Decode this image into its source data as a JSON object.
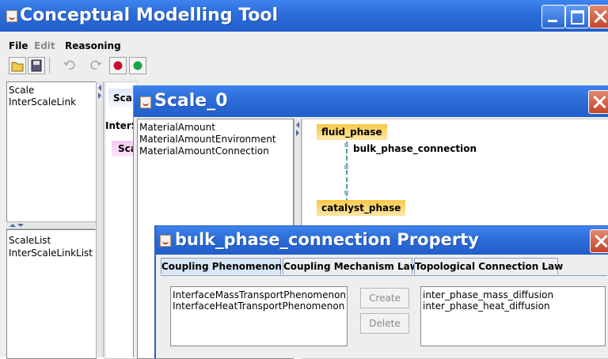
{
  "main_window": {
    "title": "Conceptual Modelling Tool",
    "menu": [
      {
        "label": "File",
        "enabled": true
      },
      {
        "label": "Edit",
        "enabled": false
      },
      {
        "label": "Reasoning",
        "enabled": true
      }
    ],
    "toolbar_icons": [
      "open-folder-icon",
      "save-icon",
      "undo-icon",
      "redo-icon",
      "red-circle-icon",
      "green-circle-icon"
    ]
  },
  "left_panel": {
    "top_list": [
      "Scale",
      "InterScaleLink"
    ],
    "bottom_list": [
      "ScaleList",
      "InterScaleLinkList"
    ]
  },
  "background_canvas": {
    "node_label": "Sca",
    "partial_label_1": "InterS",
    "partial_label_2": "Sca"
  },
  "scale_window": {
    "title": "Scale_0",
    "list": [
      "MaterialAmount",
      "MaterialAmountEnvironment",
      "MaterialAmountConnection"
    ],
    "graph": {
      "node_top": "fluid_phase",
      "edge": "bulk_phase_connection",
      "node_bottom": "catalyst_phase"
    }
  },
  "property_window": {
    "title": "bulk_phase_connection Property",
    "tabs": [
      "Coupling Phenomenon",
      "Coupling Mechanism Law",
      "Topological Connection Law"
    ],
    "active_tab": 0,
    "left_list": [
      "InterfaceMassTransportPhenomenon",
      "InterfaceHeatTransportPhenomenon"
    ],
    "buttons": {
      "create": "Create",
      "delete": "Delete"
    },
    "right_list": [
      "inter_phase_mass_diffusion",
      "inter_phase_heat_diffusion"
    ]
  },
  "colors": {
    "titlebar": "#2b6cd7",
    "node_fill": "#f7c948",
    "close_button": "#c4452a"
  }
}
